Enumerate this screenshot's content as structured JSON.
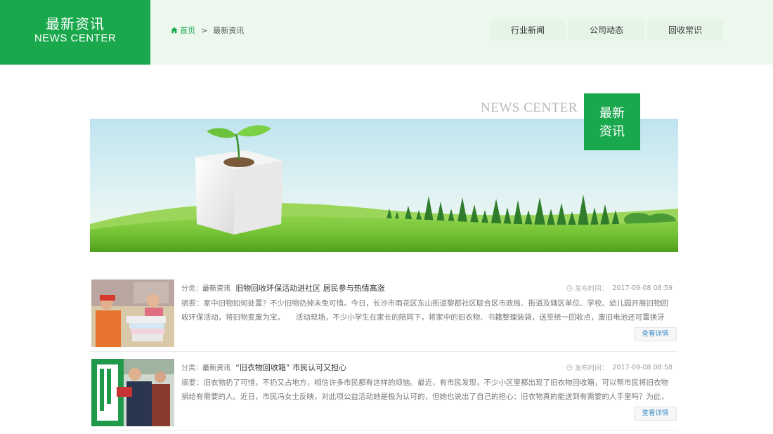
{
  "header": {
    "title_cn": "最新资讯",
    "title_en": "NEWS CENTER",
    "breadcrumb": {
      "home": "首页",
      "separator": ">",
      "current": "最新资讯"
    },
    "subnav": [
      "行业新闻",
      "公司动态",
      "回收常识"
    ]
  },
  "section": {
    "title_en": "NEWS CENTER",
    "badge_line1": "最新",
    "badge_line2": "资讯"
  },
  "news": [
    {
      "category_label": "分类：",
      "category": "最新资讯",
      "title": "旧物回收环保活动进社区 居民参与热情高涨",
      "time_label": "发布时间：",
      "time": "2017-09-08 08:59",
      "summary_label": "摘要：",
      "summary": "家中旧物如何处置？不少旧物扔掉未免可惜。今日，长沙市雨花区东山街道黎郡社区联合区市政局、街道及辖区单位、学校、幼儿园开展旧物回收环保活动，将旧物变废为宝。　　活动现场，不少小学生在家长的陪同下，将家中的旧衣物、书籍整理装袋，送至统一回收点，废旧电池还可置换牙刷、环保纸杯、洗...",
      "more": "查看详情"
    },
    {
      "category_label": "分类：",
      "category": "最新资讯",
      "title": "“旧衣物回收箱” 市民认可又担心",
      "time_label": "发布时间：",
      "time": "2017-09-08 08:58",
      "summary_label": "摘要：",
      "summary": "旧衣物扔了可惜，不扔又占地方，相信许多市民都有这样的烦恼。最近，有市民发现，不少小区里都出现了旧衣物回收箱，可以帮市民将旧衣物捐给有需要的人。近日，市民冯女士反映，对此项公益活动她是极为认可的，但她也说出了自己的担心：旧衣物真的能送到有需要的人手里吗？为此，记者进行了采访了解...",
      "more": "查看详情"
    }
  ],
  "colors": {
    "brand_green": "#1aa84d",
    "header_bg": "#ecf8ee",
    "link_blue": "#3a8ec9"
  },
  "icons": {
    "breadcrumb": "home-icon",
    "time": "clock-icon"
  }
}
